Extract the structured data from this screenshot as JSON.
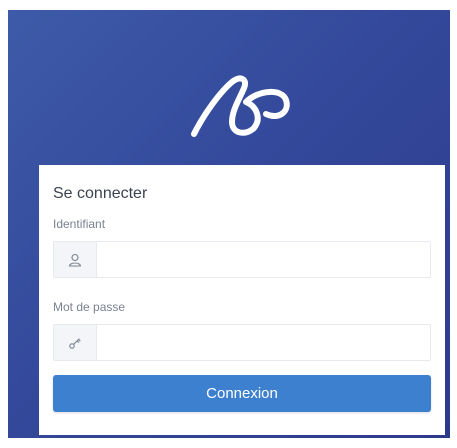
{
  "login": {
    "title": "Se connecter",
    "username": {
      "label": "Identifiant",
      "value": "",
      "icon": "user-icon"
    },
    "password": {
      "label": "Mot de passe",
      "value": "",
      "icon": "key-icon"
    },
    "submit_label": "Connexion"
  },
  "colors": {
    "background_gradient_start": "#3d5ba8",
    "background_gradient_end": "#2c3a8c",
    "accent": "#3d80cf"
  },
  "icons": {
    "logo": "brand-logo"
  }
}
